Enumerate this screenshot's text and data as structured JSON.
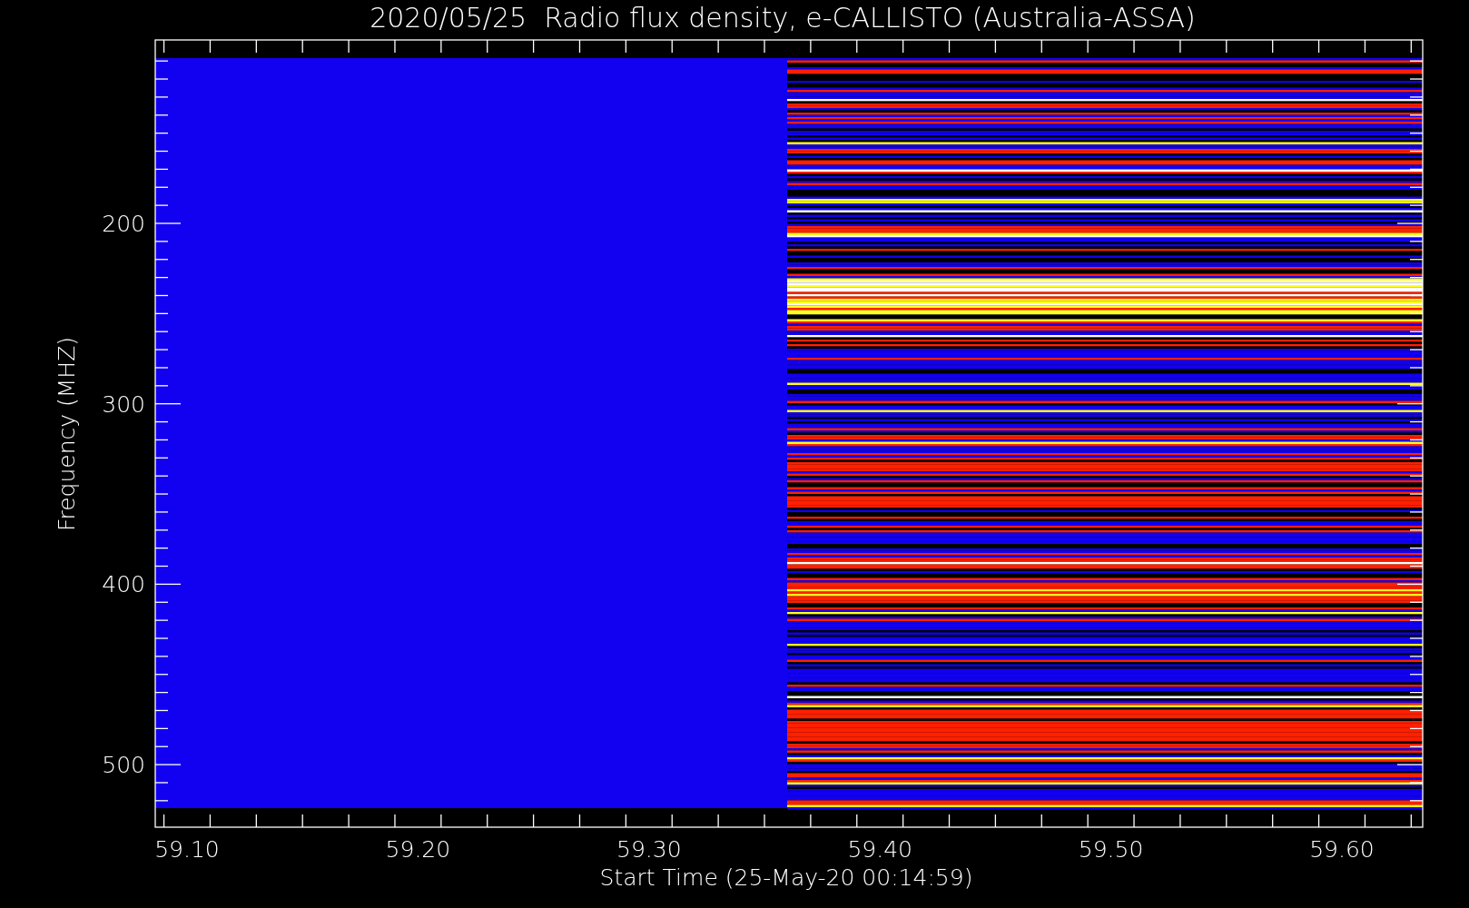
{
  "title": "2020/05/25  Radio flux density, e-CALLISTO (Australia-ASSA)",
  "ylabel": "Frequency (MHZ)",
  "xlabel": "Start Time (25-May-20 00:14:59)",
  "yticks": [
    "200",
    "300",
    "400",
    "500"
  ],
  "xticks": [
    "59.10",
    "59.20",
    "59.30",
    "59.40",
    "59.50",
    "59.60"
  ]
}
